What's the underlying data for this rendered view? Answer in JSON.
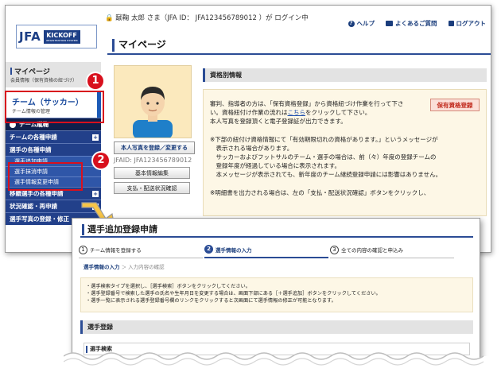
{
  "header": {
    "logo_jfa": "JFA",
    "logo_kickoff": "KICKOFF",
    "logo_kickoff_sub": "REGISTRATION SYSTEM",
    "user_line": "🔒 蹴鞠 太郎 さま（JFA ID： JFA123456789012 ）が ログイン中",
    "links": [
      {
        "label": "ヘルプ",
        "icon": "question-icon"
      },
      {
        "label": "よくあるご質問",
        "icon": "faq-icon"
      },
      {
        "label": "ログアウト",
        "icon": "lock-icon"
      }
    ],
    "page_title": "マイページ"
  },
  "sidebar": {
    "mypage_title": "マイページ",
    "mypage_sub": "会員情報（保有資格の紐づけ）",
    "team_title": "チーム（サッカー）",
    "team_sub": "チーム情報の管理",
    "items": [
      {
        "label": "チーム蹴鞠",
        "type": "dark"
      },
      {
        "label": "チームの各種申請",
        "type": "row",
        "plus": "+"
      },
      {
        "label": "選手の各種申請",
        "type": "row",
        "plus": ""
      },
      {
        "label": "選手追加申請",
        "type": "sub"
      },
      {
        "label": "選手抹消申請",
        "type": "sub"
      },
      {
        "label": "選手情報変更申請",
        "type": "sub"
      },
      {
        "label": "移籍選手の各種申請",
        "type": "row",
        "plus": "+"
      },
      {
        "label": "状況確認・再申請",
        "type": "row",
        "plus": "+"
      },
      {
        "label": "選手写真の登録・修正",
        "type": "row",
        "plus": ""
      }
    ]
  },
  "profile": {
    "photo_button": "本人写真を登録／変更する",
    "jfaid": "JFAID: JFA123456789012",
    "basic_edit": "基本情報編集",
    "payment_check": "支払・配送状況確認"
  },
  "qualification": {
    "heading": "資格別情報",
    "button": "保有資格登録",
    "line1": "審判、指導者の方は、「保有資格登録」から資格紐づけ作業を行って下さ",
    "line2_a": "い。資格紐付け作業の流れは",
    "line2_link": "こちら",
    "line2_b": "をクリックして下さい。",
    "line3": "本人写真を登録頂くと電子登録証が出力できます。",
    "note1": "※下部の紐付け資格情報にて「有効期限切れの資格があります。」というメッセージが",
    "note2": "　表示される場合があります。",
    "note3": "　サッカーおよびフットサルのチーム・選手の場合は、前（々）年度の登録チームの",
    "note4": "　登録年度が経過している場合に表示されます。",
    "note5": "　本メッセージが表示されても、新年度のチーム継続登録申請には影響はありません。",
    "note6": "※明細書を出力される場合は、左の「支払・配送状況確認」ボタンをクリックし、"
  },
  "callouts": {
    "badge1": "1",
    "badge2": "2"
  },
  "front": {
    "title": "選手追加登録申請",
    "steps": [
      {
        "num": "1",
        "label": "チーム情報を登録する"
      },
      {
        "num": "2",
        "label": "選手情報の入力"
      },
      {
        "num": "3",
        "label": "全ての内容の確認と申込み"
      }
    ],
    "crumb_current": "選手情報の入力",
    "crumb_next": "＞ 入力内容の確認",
    "notice": [
      "・選手検索タイプを選択し、［選手検索］ボタンをクリックしてください。",
      "・選手登録番号で検索した選手の氏名や生年月日を変更する場合は、画面下部にある［＋選手追加］ボタンをクリックしてください。",
      "・選手一覧に表示される選手登録番号欄のリンクをクリックすると次画面にて選手情報の修正が可能となります。"
    ],
    "section": "選手登録",
    "subsection": "選手検索"
  },
  "colors": {
    "accent": "#2b4c95",
    "callout": "#d8101d",
    "notice_bg": "#fdf7e6"
  }
}
